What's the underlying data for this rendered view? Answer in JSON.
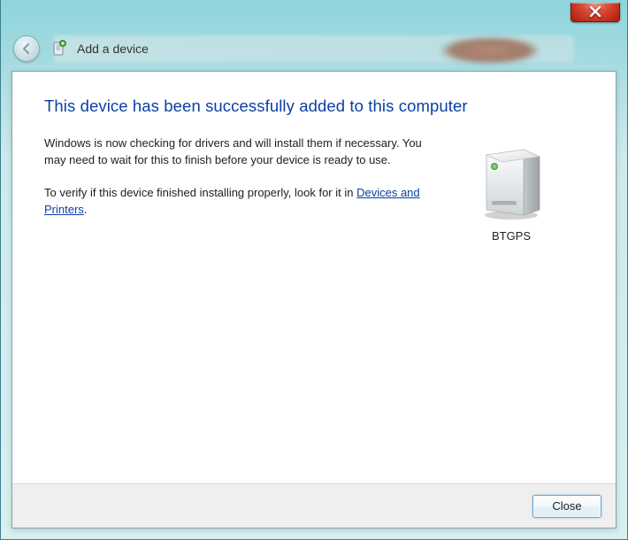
{
  "header": {
    "wizard_title": "Add a device"
  },
  "main": {
    "heading": "This device has been successfully added to this computer",
    "para1": "Windows is now checking for drivers and will install them if necessary. You may need to wait for this to finish before your device is ready to use.",
    "para2_prefix": "To verify if this device finished installing properly, look for it in ",
    "para2_link": "Devices and Printers",
    "para2_suffix": "."
  },
  "device": {
    "name": "BTGPS"
  },
  "footer": {
    "close_label": "Close"
  }
}
